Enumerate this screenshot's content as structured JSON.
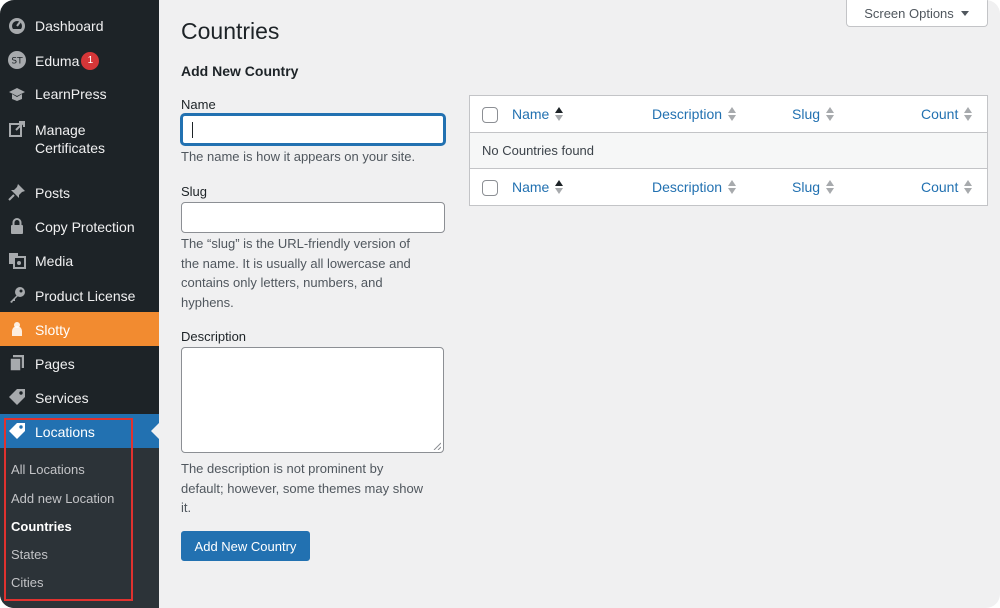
{
  "sidebar": {
    "items": [
      {
        "name": "dashboard",
        "label": "Dashboard",
        "icon": "dashboard-gauge-icon"
      },
      {
        "name": "eduma",
        "label": "Eduma",
        "icon": "eduma-logo-icon",
        "badge": "1"
      },
      {
        "name": "learnpress",
        "label": "LearnPress",
        "icon": "graduation-cap-icon"
      },
      {
        "name": "manage-certificates",
        "label_line1": "Manage",
        "label_line2": "Certificates",
        "icon": "external-link-icon"
      },
      {
        "name": "posts",
        "label": "Posts",
        "icon": "pushpin-icon"
      },
      {
        "name": "copy-protection",
        "label": "Copy Protection",
        "icon": "lock-icon"
      },
      {
        "name": "media",
        "label": "Media",
        "icon": "media-icon"
      },
      {
        "name": "product-license",
        "label": "Product License",
        "icon": "key-icon"
      },
      {
        "name": "slotty",
        "label": "Slotty",
        "icon": "people-icon"
      },
      {
        "name": "pages",
        "label": "Pages",
        "icon": "pages-icon"
      },
      {
        "name": "services",
        "label": "Services",
        "icon": "tag-icon"
      },
      {
        "name": "locations",
        "label": "Locations",
        "icon": "tag-icon"
      }
    ],
    "submenu": [
      {
        "label": "All Locations"
      },
      {
        "label": "Add new Location"
      },
      {
        "label": "Countries"
      },
      {
        "label": "States"
      },
      {
        "label": "Cities"
      }
    ],
    "colors": {
      "background": "#1d2327",
      "slotty_active": "#f28b30",
      "locations_active": "#2271b1",
      "badge": "#d63638"
    }
  },
  "header": {
    "screen_options": "Screen Options"
  },
  "main": {
    "title": "Countries",
    "form": {
      "title": "Add New Country",
      "name_label": "Name",
      "name_value": "",
      "name_help": "The name is how it appears on your site.",
      "slug_label": "Slug",
      "slug_value": "",
      "slug_help_lines": [
        "The “slug” is the URL-friendly version of",
        "the name. It is usually all lowercase and",
        "contains only letters, numbers, and",
        "hyphens."
      ],
      "description_label": "Description",
      "description_value": "",
      "description_help_lines": [
        "The description is not prominent by",
        "default; however, some themes may show",
        "it."
      ],
      "submit_label": "Add New Country"
    },
    "table": {
      "columns": [
        "Name",
        "Description",
        "Slug",
        "Count"
      ],
      "empty_message": "No Countries found",
      "sorted_column": "Name"
    }
  }
}
